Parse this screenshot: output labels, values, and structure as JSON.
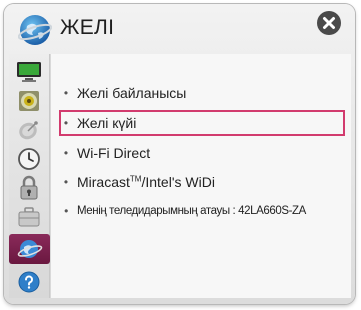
{
  "header": {
    "title": "ЖЕЛІ",
    "icon": "network-globe-icon"
  },
  "close_icon": "close-icon",
  "sidebar": {
    "items": [
      {
        "icon": "picture-icon"
      },
      {
        "icon": "sound-icon"
      },
      {
        "icon": "channel-satellite-icon"
      },
      {
        "icon": "time-clock-icon"
      },
      {
        "icon": "lock-icon"
      },
      {
        "icon": "option-briefcase-icon"
      },
      {
        "icon": "network-icon",
        "selected": true
      },
      {
        "icon": "support-help-icon"
      }
    ]
  },
  "menu": {
    "items": [
      {
        "label": "Желі байланысы"
      },
      {
        "label": "Желі күйі",
        "highlighted": true
      },
      {
        "label": "Wi-Fi Direct"
      },
      {
        "label_main": "Miracast",
        "label_sup": "TM",
        "label_rest": "/Intel's WiDi"
      },
      {
        "label": "Менің теледидарымның атауы : 42LA660S-ZA"
      }
    ]
  },
  "colors": {
    "highlight_border": "#d23b6e",
    "selected_sidebar": "#7a1f4d"
  }
}
